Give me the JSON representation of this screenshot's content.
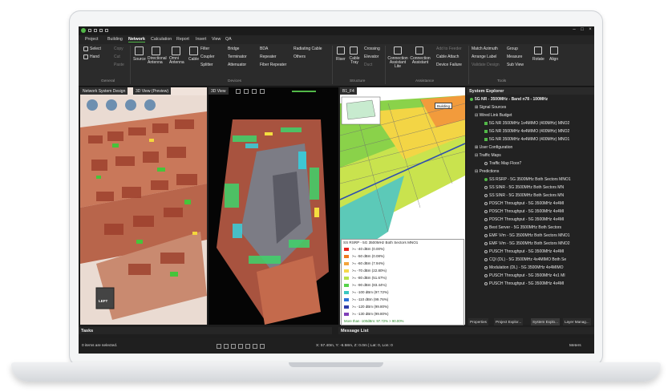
{
  "menu": {
    "items": [
      "Project",
      "Building",
      "Network",
      "Calculation",
      "Report",
      "Insert",
      "View",
      "QA"
    ],
    "active": "Network"
  },
  "ribbon": {
    "general": {
      "select": "Select",
      "hand": "Hand",
      "copy": "Copy",
      "cut": "Cut",
      "paste": "Paste",
      "label": "General"
    },
    "devices": {
      "source": "Source",
      "directional_antenna": "Directional Antenna",
      "omni_antenna": "Omni Antenna",
      "cable": "Cable",
      "filter": "Filter",
      "coupler": "Coupler",
      "splitter": "Splitter",
      "bridge": "Bridge",
      "terminator": "Terminator",
      "attenuator": "Attenuator",
      "bda": "BDA",
      "repeater": "Repeater",
      "fiber_repeater": "Fiber Repeater",
      "radiating_cable": "Radiating Cable",
      "others": "Others",
      "label": "Devices"
    },
    "structure": {
      "riser": "Riser",
      "cable_tray": "Cable Tray",
      "crossing": "Crossing",
      "elevator": "Elevator",
      "duct": "Duct",
      "label": "Structure"
    },
    "assistance": {
      "conn_lite": "Connection Assistant Lite",
      "conn": "Connection Assistant",
      "add_to_feeder": "Add to Feeder",
      "cable_attach": "Cable Attach",
      "device_failure": "Device Failure",
      "label": "Assistance"
    },
    "tools": {
      "match_azimuth": "Match Azimuth",
      "arrange_label": "Arrange Label",
      "validate_design": "Validate Design",
      "group": "Group",
      "measure": "Measure",
      "sub_view": "Sub View",
      "rotate": "Rotate",
      "align": "Align",
      "label": "Tools"
    }
  },
  "viewports": {
    "tab1": "Network System Design",
    "tab2": "3D View (Preview)",
    "tab3": "3D View",
    "tab4": "B1_F4",
    "building_label": "Building",
    "nav_lefty": "LEFT"
  },
  "legend": {
    "title": "SS RSRP - 5G 3500MHz Both Sectors MNO1",
    "rows": [
      {
        "label": ">= -40 dBm  (0.00%)",
        "color": "#e8231c"
      },
      {
        "label": ">= -50 dBm  (0.08%)",
        "color": "#f07a1e"
      },
      {
        "label": ">= -60 dBm  (7.94%)",
        "color": "#f3a43c"
      },
      {
        "label": ">= -70 dBm  (22.80%)",
        "color": "#f6d84a"
      },
      {
        "label": ">= -80 dBm  (51.67%)",
        "color": "#b7e24a"
      },
      {
        "label": ">= -90 dBm  (83.44%)",
        "color": "#57d24a"
      },
      {
        "label": ">= -100 dBm  (97.72%)",
        "color": "#38c6c0"
      },
      {
        "label": ">= -110 dBm  (99.76%)",
        "color": "#2a6fd8"
      },
      {
        "label": ">= -120 dBm  (99.80%)",
        "color": "#2c3ba8"
      },
      {
        "label": ">= -130 dBm  (99.80%)",
        "color": "#7f3fb8"
      }
    ],
    "footer": "More than  -100dBm: 97.72% > 90.00%"
  },
  "system_explorer": {
    "title": "System Explorer",
    "root": "5G NR - 3500MHz - Band n78 - 100MHz",
    "signal_sources": "Signal Sources",
    "wired_link_budget": "Wired Link Budget",
    "links": [
      "5G NR 3500MHz 1x4MIMO (400MHz) MNO2",
      "5G NR 3500MHz 4x4MIMO (400MHz) MNO2",
      "5G NR 3500MHz 4x4MIMO (400MHz) MNO1"
    ],
    "user_configuration": "User Configuration",
    "traffic_maps": "Traffic Maps",
    "traffic_map_floor": "Traffic Map Floor7",
    "predictions": "Predictions",
    "prediction_items": [
      "SS RSRP - 5G 3500MHz Both Sectors MNO1",
      "SS SINR - 5G 3500MHz Both Sectors MN",
      "SS SINR - 5G 3500MHz Both Sectors MN",
      "PDSCH Throughput - 5G 3500MHz 4x4MI",
      "PDSCH Throughput - 5G 3500MHz 4x4MI",
      "PDSCH Throughput - 5G 3500MHz 4x4MI",
      "Best Server - 5G 3500MHz Both Sectors",
      "EMF V/m - 5G 3500MHz Both Sectors MNO1",
      "EMF V/m - 5G 3500MHz Both Sectors MNO2",
      "PUSCH Throughput - 5G 3500MHz 4x4MI",
      "CQI (DL) - 5G 3500MHz 4x4MIMO Both Se",
      "Modulation (DL) - 5G 3500MHz 4x4MIMO",
      "PUSCH Throughput - 5G 3500MHz 4x1 MI",
      "PUSCH Throughput - 5G 3500MHz 4x4MI"
    ],
    "tabs": [
      "Properties",
      "Project Explor...",
      "System Explo...",
      "Layer Manag..."
    ]
  },
  "bottom": {
    "tasks_title": "Tasks",
    "message_list_title": "Message List",
    "selection_status": "0 items are selected.",
    "coords": "X: 57.40m, Y: -6.58m, Z: 0.0m  |  Lat: 0, Lon: 0",
    "units": "Meters"
  }
}
